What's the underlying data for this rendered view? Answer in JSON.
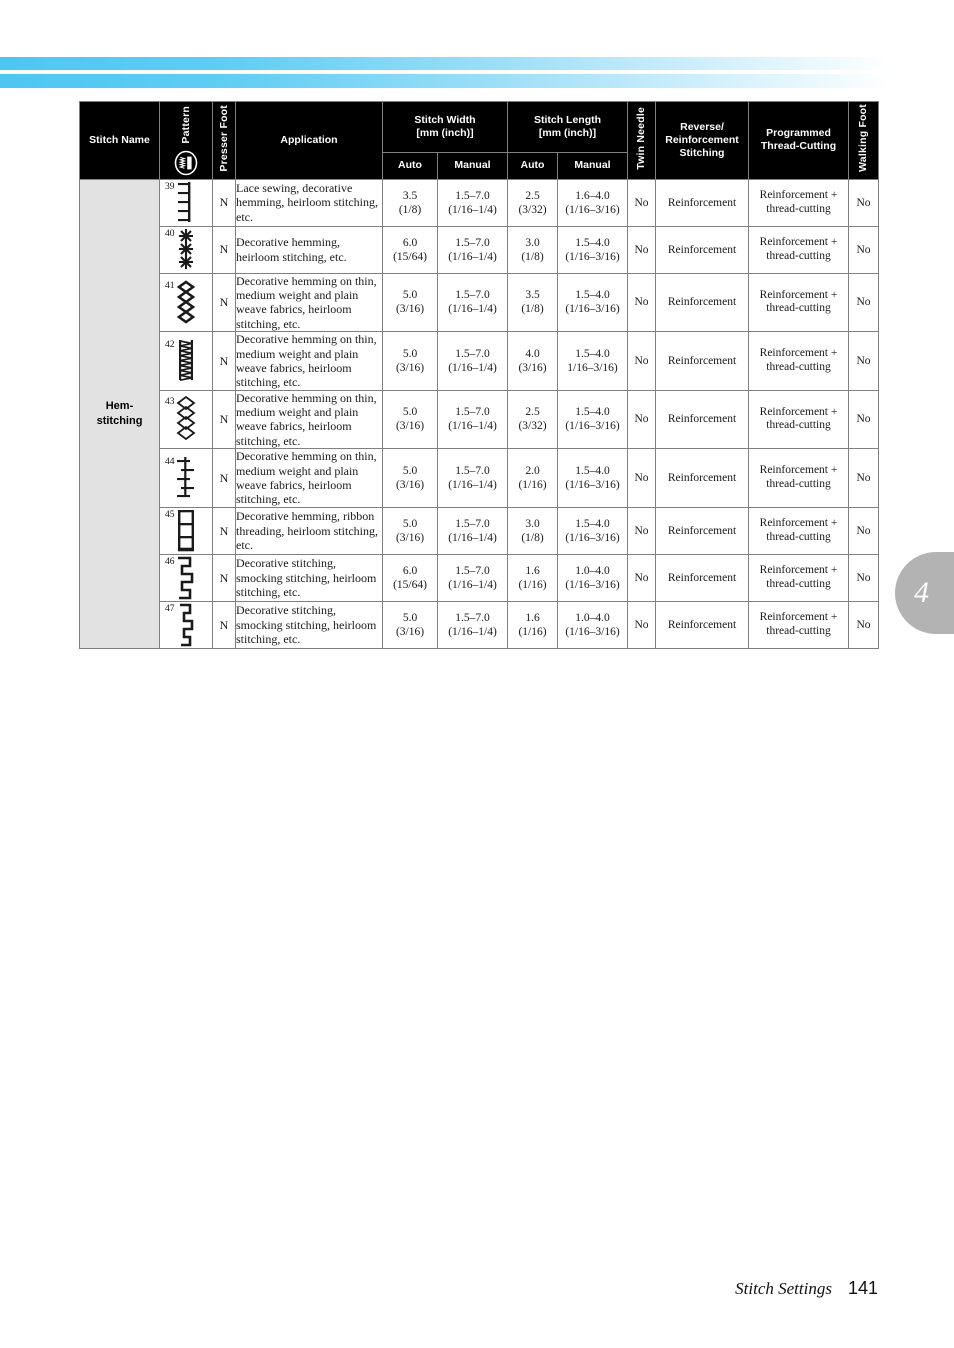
{
  "document": {
    "footer_title": "Stitch Settings",
    "page_number": "141",
    "chapter_tab": "4"
  },
  "table": {
    "headers": {
      "stitch_name": "Stitch Name",
      "pattern": "Pattern",
      "presser_foot": "Presser Foot",
      "application": "Application",
      "stitch_width": "Stitch Width\n[mm (inch)]",
      "stitch_width_line1": "Stitch Width",
      "stitch_width_line2": "[mm (inch)]",
      "stitch_length_line1": "Stitch Length",
      "stitch_length_line2": "[mm (inch)]",
      "auto": "Auto",
      "manual": "Manual",
      "twin_needle": "Twin Needle",
      "reverse_reinforcement": "Reverse/\nReinforcement\nStitching",
      "reverse_line1": "Reverse/",
      "reverse_line2": "Reinforcement",
      "reverse_line3": "Stitching",
      "programmed_line1": "Programmed",
      "programmed_line2": "Thread-Cutting",
      "walking_foot": "Walking Foot",
      "pattern_icon": "stitch-selector-icon"
    },
    "group_name": "Hem-\nstitching",
    "group_name_line1": "Hem-",
    "group_name_line2": "stitching",
    "rows": [
      {
        "number": "39",
        "pattern_icon": "comb-stitch-icon",
        "presser_foot": "N",
        "application": "Lace sewing, decorative hemming, heirloom stitching, etc.",
        "width_auto_mm": "3.5",
        "width_auto_in": "(1/8)",
        "width_manual_mm": "1.5–7.0",
        "width_manual_in": "(1/16–1/4)",
        "length_auto_mm": "2.5",
        "length_auto_in": "(3/32)",
        "length_manual_mm": "1.6–4.0",
        "length_manual_in": "(1/16–3/16)",
        "twin_needle": "No",
        "reverse_reinforcement": "Reinforcement",
        "programmed_line1": "Reinforcement +",
        "programmed_line2": "thread-cutting",
        "walking_foot": "No"
      },
      {
        "number": "40",
        "pattern_icon": "asterisk-stitch-icon",
        "presser_foot": "N",
        "application": "Decorative hemming, heirloom stitching, etc.",
        "width_auto_mm": "6.0",
        "width_auto_in": "(15/64)",
        "width_manual_mm": "1.5–7.0",
        "width_manual_in": "(1/16–1/4)",
        "length_auto_mm": "3.0",
        "length_auto_in": "(1/8)",
        "length_manual_mm": "1.5–4.0",
        "length_manual_in": "(1/16–3/16)",
        "twin_needle": "No",
        "reverse_reinforcement": "Reinforcement",
        "programmed_line1": "Reinforcement +",
        "programmed_line2": "thread-cutting",
        "walking_foot": "No"
      },
      {
        "number": "41",
        "pattern_icon": "diamond-chain-stitch-icon",
        "presser_foot": "N",
        "application": "Decorative hemming on thin, medium weight and plain weave fabrics, heirloom stitching, etc.",
        "width_auto_mm": "5.0",
        "width_auto_in": "(3/16)",
        "width_manual_mm": "1.5–7.0",
        "width_manual_in": "(1/16–1/4)",
        "length_auto_mm": "3.5",
        "length_auto_in": "(1/8)",
        "length_manual_mm": "1.5–4.0",
        "length_manual_in": "(1/16–3/16)",
        "twin_needle": "No",
        "reverse_reinforcement": "Reinforcement",
        "programmed_line1": "Reinforcement +",
        "programmed_line2": "thread-cutting",
        "walking_foot": "No"
      },
      {
        "number": "42",
        "pattern_icon": "dense-zigzag-ladder-icon",
        "presser_foot": "N",
        "application": "Decorative hemming on thin, medium weight and plain weave fabrics, heirloom stitching, etc.",
        "width_auto_mm": "5.0",
        "width_auto_in": "(3/16)",
        "width_manual_mm": "1.5–7.0",
        "width_manual_in": "(1/16–1/4)",
        "length_auto_mm": "4.0",
        "length_auto_in": "(3/16)",
        "length_manual_mm": "1.5–4.0",
        "length_manual_in": "1/16–3/16)",
        "twin_needle": "No",
        "reverse_reinforcement": "Reinforcement",
        "programmed_line1": "Reinforcement +",
        "programmed_line2": "thread-cutting",
        "walking_foot": "No"
      },
      {
        "number": "43",
        "pattern_icon": "open-diamond-chain-icon",
        "presser_foot": "N",
        "application": "Decorative hemming on thin, medium weight and plain weave fabrics, heirloom stitching, etc.",
        "width_auto_mm": "5.0",
        "width_auto_in": "(3/16)",
        "width_manual_mm": "1.5–7.0",
        "width_manual_in": "(1/16–1/4)",
        "length_auto_mm": "2.5",
        "length_auto_in": "(3/32)",
        "length_manual_mm": "1.5–4.0",
        "length_manual_in": "(1/16–3/16)",
        "twin_needle": "No",
        "reverse_reinforcement": "Reinforcement",
        "programmed_line1": "Reinforcement +",
        "programmed_line2": "thread-cutting",
        "walking_foot": "No"
      },
      {
        "number": "44",
        "pattern_icon": "cross-rung-stitch-icon",
        "presser_foot": "N",
        "application": "Decorative hemming on thin, medium weight and plain weave fabrics, heirloom stitching, etc.",
        "width_auto_mm": "5.0",
        "width_auto_in": "(3/16)",
        "width_manual_mm": "1.5–7.0",
        "width_manual_in": "(1/16–1/4)",
        "length_auto_mm": "2.0",
        "length_auto_in": "(1/16)",
        "length_manual_mm": "1.5–4.0",
        "length_manual_in": "(1/16–3/16)",
        "twin_needle": "No",
        "reverse_reinforcement": "Reinforcement",
        "programmed_line1": "Reinforcement +",
        "programmed_line2": "thread-cutting",
        "walking_foot": "No"
      },
      {
        "number": "45",
        "pattern_icon": "ladder-stitch-icon",
        "presser_foot": "N",
        "application": "Decorative hemming, ribbon threading, heirloom stitching, etc.",
        "width_auto_mm": "5.0",
        "width_auto_in": "(3/16)",
        "width_manual_mm": "1.5–7.0",
        "width_manual_in": "(1/16–1/4)",
        "length_auto_mm": "3.0",
        "length_auto_in": "(1/8)",
        "length_manual_mm": "1.5–4.0",
        "length_manual_in": "(1/16–3/16)",
        "twin_needle": "No",
        "reverse_reinforcement": "Reinforcement",
        "programmed_line1": "Reinforcement +",
        "programmed_line2": "thread-cutting",
        "walking_foot": "No"
      },
      {
        "number": "46",
        "pattern_icon": "wide-step-stitch-icon",
        "presser_foot": "N",
        "application": "Decorative stitching, smocking stitching, heirloom stitching, etc.",
        "width_auto_mm": "6.0",
        "width_auto_in": "(15/64)",
        "width_manual_mm": "1.5–7.0",
        "width_manual_in": "(1/16–1/4)",
        "length_auto_mm": "1.6",
        "length_auto_in": "(1/16)",
        "length_manual_mm": "1.0–4.0",
        "length_manual_in": "(1/16–3/16)",
        "twin_needle": "No",
        "reverse_reinforcement": "Reinforcement",
        "programmed_line1": "Reinforcement +",
        "programmed_line2": "thread-cutting",
        "walking_foot": "No"
      },
      {
        "number": "47",
        "pattern_icon": "narrow-step-stitch-icon",
        "presser_foot": "N",
        "application": "Decorative stitching, smocking stitching, heirloom stitching, etc.",
        "width_auto_mm": "5.0",
        "width_auto_in": "(3/16)",
        "width_manual_mm": "1.5–7.0",
        "width_manual_in": "(1/16–1/4)",
        "length_auto_mm": "1.6",
        "length_auto_in": "(1/16)",
        "length_manual_mm": "1.0–4.0",
        "length_manual_in": "(1/16–3/16)",
        "twin_needle": "No",
        "reverse_reinforcement": "Reinforcement",
        "programmed_line1": "Reinforcement +",
        "programmed_line2": "thread-cutting",
        "walking_foot": "No"
      }
    ]
  },
  "colors": {
    "header_band_start": "#4ec6f2",
    "header_band_end": "#ffffff",
    "table_header_bg": "#000000",
    "name_cell_bg": "#e2e2e2",
    "tab_bg": "#b3b3b3",
    "border": "#808080"
  }
}
